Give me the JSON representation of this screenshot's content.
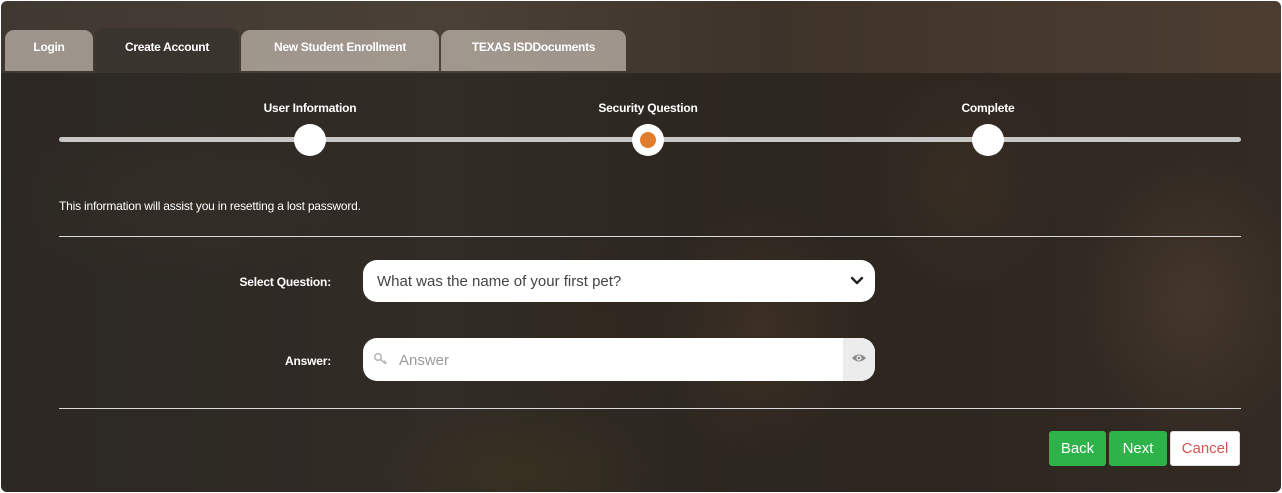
{
  "tabs": [
    {
      "label": "Login"
    },
    {
      "label": "Create Account"
    },
    {
      "label": "New Student Enrollment"
    },
    {
      "label": "TEXAS ISDDocuments"
    }
  ],
  "steps": [
    {
      "label": "User Information"
    },
    {
      "label": "Security Question"
    },
    {
      "label": "Complete"
    }
  ],
  "current_step": "Security Question",
  "info_text": "This information will assist you in resetting a lost password.",
  "question": {
    "label": "Select Question:",
    "value": "What was the name of your first pet?"
  },
  "answer": {
    "label": "Answer:",
    "placeholder": "Answer",
    "value": ""
  },
  "buttons": {
    "back": "Back",
    "next": "Next",
    "cancel": "Cancel"
  },
  "colors": {
    "active_step": "#e07d2c",
    "primary_button": "#2db34a",
    "cancel_text": "#d9534f"
  },
  "icons": [
    "key-icon",
    "eye-icon",
    "chevron-down-icon"
  ]
}
